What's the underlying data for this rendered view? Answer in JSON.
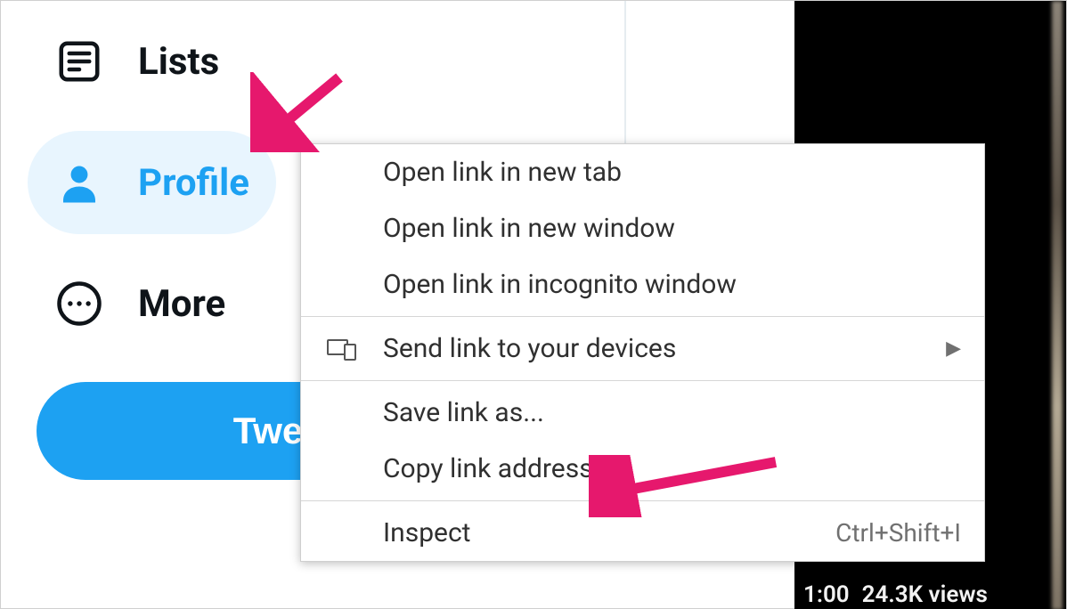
{
  "colors": {
    "accent": "#1da1f2",
    "accent_light": "#e8f5fe",
    "annotation": "#e6186d",
    "text": "#0f1419"
  },
  "sidebar": {
    "items": [
      {
        "label": "Lists",
        "icon": "list-icon",
        "active": false
      },
      {
        "label": "Profile",
        "icon": "person-icon",
        "active": true
      },
      {
        "label": "More",
        "icon": "more-icon",
        "active": false
      }
    ],
    "tweet_label": "Twe"
  },
  "context_menu": {
    "items": [
      {
        "label": "Open link in new tab"
      },
      {
        "label": "Open link in new window"
      },
      {
        "label": "Open link in incognito window"
      }
    ],
    "send_devices": {
      "label": "Send link to your devices",
      "has_submenu": true,
      "icon": "devices-icon"
    },
    "link_actions": [
      {
        "label": "Save link as..."
      },
      {
        "label": "Copy link address"
      }
    ],
    "inspect": {
      "label": "Inspect",
      "shortcut": "Ctrl+Shift+I"
    }
  },
  "video": {
    "time": "1:00",
    "views": "24.3K views"
  }
}
